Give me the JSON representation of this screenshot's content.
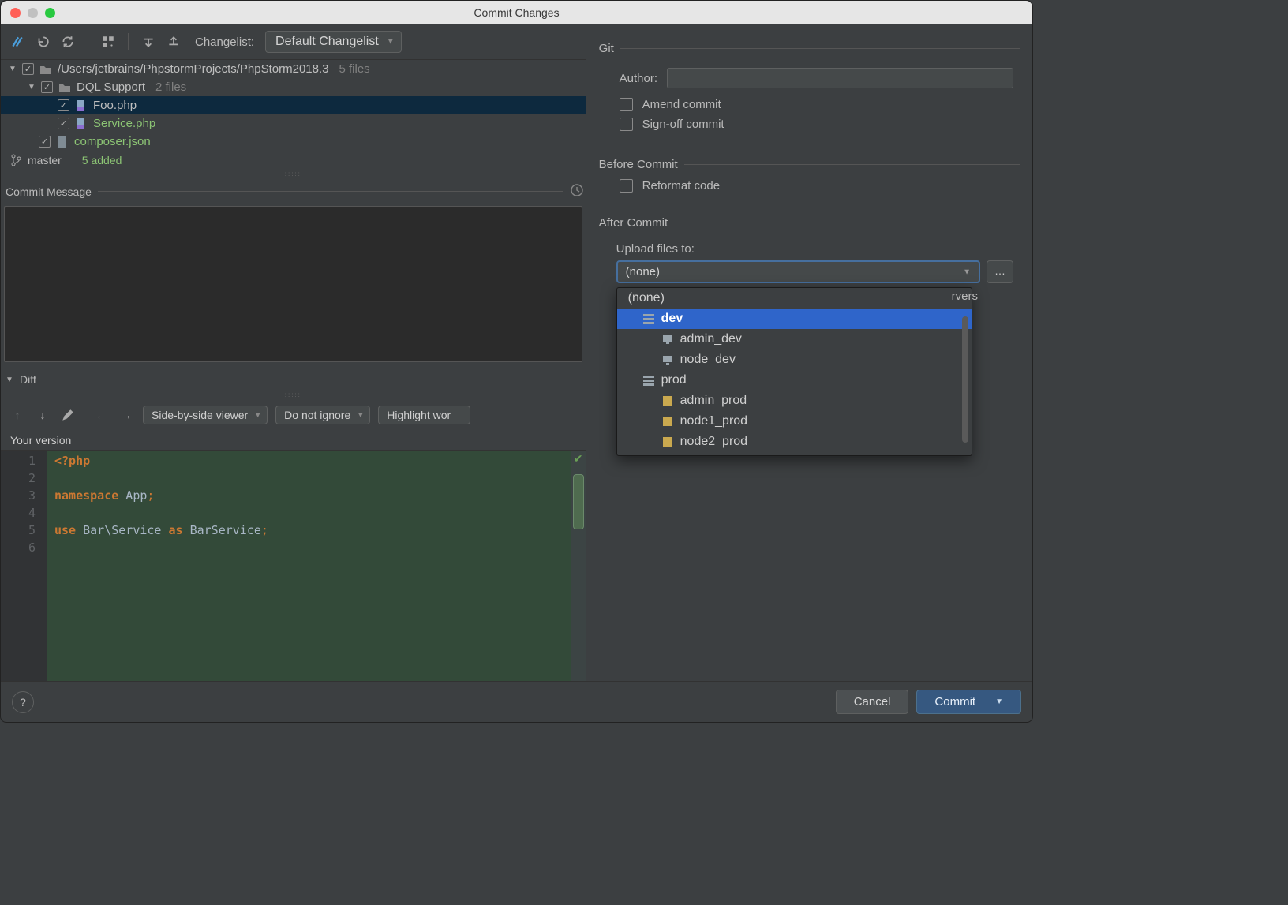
{
  "title": "Commit Changes",
  "toolbar": {
    "changelist_label": "Changelist:",
    "changelist_value": "Default Changelist"
  },
  "tree": {
    "root": {
      "path": "/Users/jetbrains/PhpstormProjects/PhpStorm2018.3",
      "count": "5 files"
    },
    "folder": {
      "name": "DQL Support",
      "count": "2 files"
    },
    "files": [
      {
        "name": "Foo.php",
        "new": false,
        "selected": true
      },
      {
        "name": "Service.php",
        "new": true,
        "selected": false
      }
    ],
    "other": {
      "name": "composer.json"
    }
  },
  "branch": {
    "name": "master",
    "status": "5 added"
  },
  "commit_message": {
    "label": "Commit Message"
  },
  "diff": {
    "label": "Diff",
    "mode": "Side-by-side viewer",
    "whitespace": "Do not ignore",
    "highlight": "Highlight wor",
    "version_label": "Your version"
  },
  "code": {
    "lines": [
      "1",
      "2",
      "3",
      "4",
      "5",
      "6"
    ],
    "l1_a": "<?php",
    "l3_a": "namespace",
    "l3_b": " App",
    "l3_c": ";",
    "l5_a": "use",
    "l5_b": " Bar\\Service ",
    "l5_c": "as",
    "l5_d": " BarService",
    "l5_e": ";"
  },
  "git": {
    "section": "Git",
    "author_label": "Author:",
    "amend": "Amend commit",
    "signoff": "Sign-off commit"
  },
  "before": {
    "section": "Before Commit",
    "reformat": "Reformat code"
  },
  "after": {
    "section": "After Commit",
    "upload_label": "Upload files to:",
    "upload_value": "(none)",
    "servers_hint": "rvers",
    "options": [
      {
        "label": "(none)",
        "indent": 0,
        "icon": "",
        "sel": false
      },
      {
        "label": "dev",
        "indent": 1,
        "icon": "group",
        "sel": true
      },
      {
        "label": "admin_dev",
        "indent": 2,
        "icon": "host",
        "sel": false
      },
      {
        "label": "node_dev",
        "indent": 2,
        "icon": "host",
        "sel": false
      },
      {
        "label": "prod",
        "indent": 1,
        "icon": "group",
        "sel": false
      },
      {
        "label": "admin_prod",
        "indent": 2,
        "icon": "sftp",
        "sel": false
      },
      {
        "label": "node1_prod",
        "indent": 2,
        "icon": "sftp",
        "sel": false
      },
      {
        "label": "node2_prod",
        "indent": 2,
        "icon": "sftp",
        "sel": false
      }
    ]
  },
  "footer": {
    "help": "?",
    "cancel": "Cancel",
    "commit": "Commit"
  }
}
